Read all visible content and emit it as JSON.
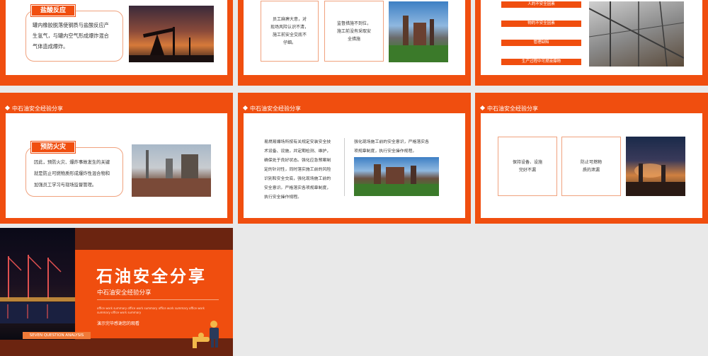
{
  "slide1": {
    "tag": "盐酸反应",
    "lines": [
      "罐内橡胶脱落使钢质与盐酸反应产",
      "生氢气，与罐内空气形成爆炸混合",
      "气体造成爆炸。"
    ]
  },
  "slide2": {
    "box1": [
      "员工麻痹大意，对",
      "现场风险认识不清，",
      "施工前安全交底不",
      "仔细。"
    ],
    "box2": [
      "监督措施不到位，",
      "施工前没有采取安",
      "全措施"
    ]
  },
  "slide3": {
    "pills": [
      "人的不安全因素",
      "物的不安全因素",
      "管理缺陷",
      "生产过程中可燃液爆物"
    ]
  },
  "slide4": {
    "header": "中石油安全经验分享",
    "tag": "预防火灾",
    "lines": [
      "因此，预防火灾、爆炸事故发生的关键",
      "就是防止可燃物质形成爆炸性混合物和",
      "加强员工学习与现场监督管理。"
    ]
  },
  "slide5": {
    "header": "中石油安全经验分享",
    "left": [
      "易燃易爆场所按有关规定安装安全技",
      "术设备、设施，并定期检测、维护，",
      "确保处于良好状态。强化应急预案制",
      "定的针对性，同时落实施工前的风险",
      "识别和安全交底，强化现场施工前的",
      "安全意识。严格落实各项规章制度，",
      "执行安全操作规程。"
    ],
    "right": [
      "强化现场施工前的安全意识，严格落实各",
      "项规章制度，执行安全操作规程。"
    ]
  },
  "slide6": {
    "header": "中石油安全经验分享",
    "box1": [
      "保持设备、设施",
      "完好不漏"
    ],
    "box2": [
      "防止可燃物",
      "质的泄漏"
    ]
  },
  "final": {
    "title": "石油安全分享",
    "subtitle": "中石油安全经验分享",
    "para": [
      "office work summary office work summary office work summary office work",
      "summary office work summary"
    ],
    "presenter": "演示完毕感谢您的观看",
    "badge": "SEVEN QUESTION ANALYSIS"
  },
  "colors": {
    "accent": "#f04e0f",
    "bg": "#e9e9e9"
  }
}
